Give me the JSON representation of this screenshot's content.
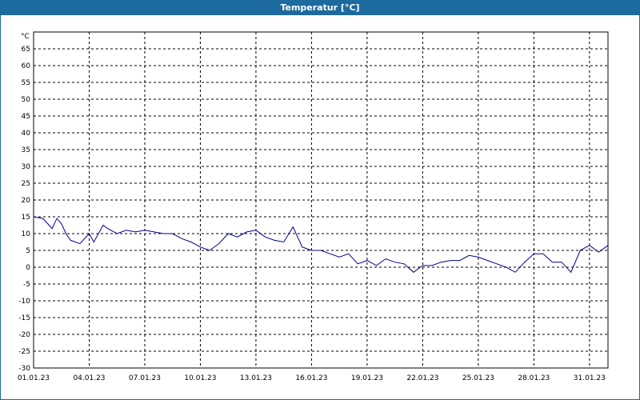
{
  "window": {
    "title": "Temperatur [°C]"
  },
  "chart_data": {
    "type": "line",
    "title": "Temperatur [°C]",
    "ylabel": "°C",
    "xlabel": "",
    "ylim": [
      -30,
      70
    ],
    "yticks": [
      -30,
      -25,
      -20,
      -15,
      -10,
      -5,
      0,
      5,
      10,
      15,
      20,
      25,
      30,
      35,
      40,
      45,
      50,
      55,
      60,
      65
    ],
    "xlim": [
      "01.01.23 00:00",
      "01.02.23 00:00"
    ],
    "xticks": [
      "01.01.23",
      "04.01.23",
      "07.01.23",
      "10.01.23",
      "13.01.23",
      "16.01.23",
      "19.01.23",
      "22.01.23",
      "25.01.23",
      "28.01.23",
      "31.01.23"
    ],
    "grid": true,
    "colors": {
      "line": "#00008b",
      "grid": "#000000",
      "frame": "#1c6a9e"
    },
    "series": [
      {
        "name": "",
        "x": [
          "01.01.23 00:00",
          "01.01.23 12:00",
          "02.01.23 00:00",
          "02.01.23 06:00",
          "02.01.23 12:00",
          "02.01.23 18:00",
          "03.01.23 00:00",
          "03.01.23 12:00",
          "04.01.23 00:00",
          "04.01.23 06:00",
          "04.01.23 12:00",
          "04.01.23 18:00",
          "05.01.23 00:00",
          "05.01.23 12:00",
          "06.01.23 00:00",
          "06.01.23 12:00",
          "07.01.23 00:00",
          "07.01.23 12:00",
          "08.01.23 00:00",
          "08.01.23 12:00",
          "09.01.23 00:00",
          "09.01.23 12:00",
          "10.01.23 00:00",
          "10.01.23 12:00",
          "11.01.23 00:00",
          "11.01.23 12:00",
          "12.01.23 00:00",
          "12.01.23 12:00",
          "13.01.23 00:00",
          "13.01.23 12:00",
          "14.01.23 00:00",
          "14.01.23 12:00",
          "15.01.23 00:00",
          "15.01.23 12:00",
          "16.01.23 00:00",
          "16.01.23 12:00",
          "17.01.23 00:00",
          "17.01.23 12:00",
          "18.01.23 00:00",
          "18.01.23 12:00",
          "19.01.23 00:00",
          "19.01.23 12:00",
          "20.01.23 00:00",
          "20.01.23 12:00",
          "21.01.23 00:00",
          "21.01.23 12:00",
          "22.01.23 00:00",
          "22.01.23 12:00",
          "23.01.23 00:00",
          "23.01.23 12:00",
          "24.01.23 00:00",
          "24.01.23 12:00",
          "25.01.23 00:00",
          "25.01.23 12:00",
          "26.01.23 00:00",
          "26.01.23 12:00",
          "27.01.23 00:00",
          "27.01.23 12:00",
          "28.01.23 00:00",
          "28.01.23 12:00",
          "29.01.23 00:00",
          "29.01.23 12:00",
          "30.01.23 00:00",
          "30.01.23 12:00",
          "31.01.23 00:00",
          "31.01.23 12:00",
          "01.02.23 00:00"
        ],
        "y": [
          15,
          14.5,
          11.5,
          14.5,
          13,
          10,
          8,
          7,
          10,
          7.5,
          10,
          12.5,
          11.5,
          10,
          11,
          10.5,
          11,
          10.5,
          10,
          10,
          8.5,
          7.5,
          6,
          5,
          7,
          10,
          9,
          10.5,
          11,
          9,
          8,
          7.5,
          12,
          6,
          5,
          5,
          4,
          3,
          4,
          1,
          2,
          0.5,
          2.5,
          1.5,
          1,
          -1.5,
          0.5,
          0.5,
          1.5,
          2,
          2,
          3.5,
          3,
          2,
          1,
          0,
          -1.5,
          1.5,
          4,
          4,
          1.5,
          1.5,
          -1.5,
          5,
          6.5,
          4.5,
          6.5
        ]
      }
    ]
  }
}
